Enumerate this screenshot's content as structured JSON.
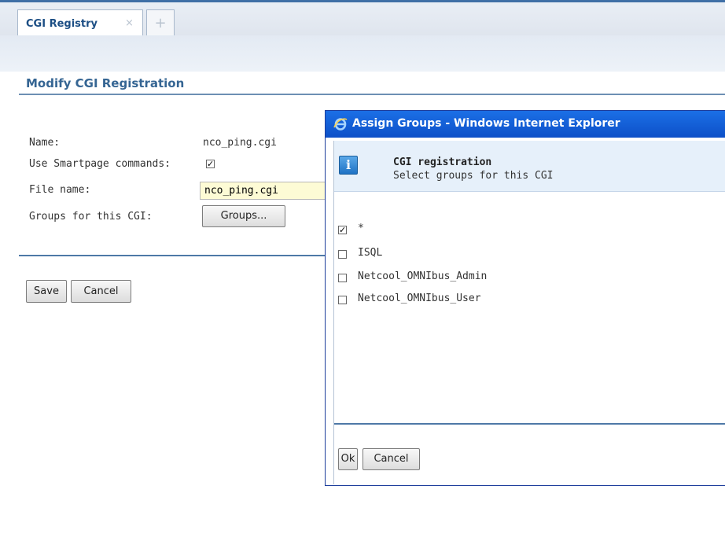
{
  "tabs": {
    "active_label": "CGI Registry",
    "close_glyph": "×",
    "new_glyph": "+"
  },
  "page": {
    "title": "Modify CGI Registration"
  },
  "form": {
    "name_label": "Name:",
    "name_value": "nco_ping.cgi",
    "smartpage_label": "Use Smartpage commands:",
    "smartpage_checked": true,
    "filename_label": "File name:",
    "filename_value": "nco_ping.cgi",
    "groups_label": "Groups for this CGI:",
    "groups_button": "Groups...",
    "save_button": "Save",
    "cancel_button": "Cancel"
  },
  "dialog": {
    "title": "Assign Groups - Windows Internet Explorer",
    "info_heading": "CGI registration",
    "info_text": "Select groups for this CGI",
    "groups": [
      {
        "label": "*",
        "checked": true
      },
      {
        "label": "ISQL",
        "checked": false
      },
      {
        "label": "Netcool_OMNIbus_Admin",
        "checked": false
      },
      {
        "label": "Netcool_OMNIbus_User",
        "checked": false
      }
    ],
    "ok_button": "Ok",
    "cancel_button": "Cancel"
  },
  "icons": {
    "tab_close": "close-icon",
    "tab_new": "plus-icon",
    "titlebar": "internet-explorer-icon",
    "info": "info-icon"
  },
  "colors": {
    "accent": "#356593",
    "titlebar": "#0d50c8",
    "input_bg": "#fdfbd5"
  }
}
